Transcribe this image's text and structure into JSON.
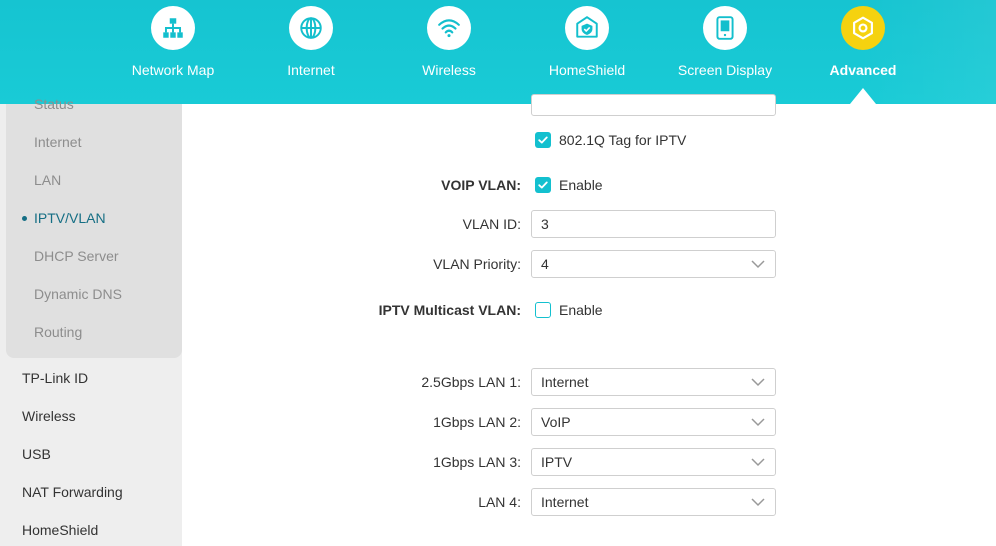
{
  "nav": {
    "items": [
      {
        "label": "Network Map",
        "icon": "network-map-icon"
      },
      {
        "label": "Internet",
        "icon": "globe-icon"
      },
      {
        "label": "Wireless",
        "icon": "wifi-icon"
      },
      {
        "label": "HomeShield",
        "icon": "home-shield-icon"
      },
      {
        "label": "Screen Display",
        "icon": "screen-display-icon"
      },
      {
        "label": "Advanced",
        "icon": "gear-icon",
        "active": true
      }
    ],
    "accent_color": "#16c4d1",
    "active_color": "#f5d20f"
  },
  "sidebar": {
    "sub_items": [
      {
        "label": "Status"
      },
      {
        "label": "Internet"
      },
      {
        "label": "LAN"
      },
      {
        "label": "IPTV/VLAN",
        "active": true
      },
      {
        "label": "DHCP Server"
      },
      {
        "label": "Dynamic DNS"
      },
      {
        "label": "Routing"
      }
    ],
    "main_items": [
      {
        "label": "TP-Link ID"
      },
      {
        "label": "Wireless"
      },
      {
        "label": "USB"
      },
      {
        "label": "NAT Forwarding"
      },
      {
        "label": "HomeShield"
      }
    ]
  },
  "form": {
    "iptv_tag_label": "802.1Q Tag for IPTV",
    "voip_vlan_label": "VOIP VLAN:",
    "voip_enable_label": "Enable",
    "vlan_id_label": "VLAN ID:",
    "vlan_id_value": "3",
    "vlan_priority_label": "VLAN Priority:",
    "vlan_priority_value": "4",
    "iptv_multicast_label": "IPTV Multicast VLAN:",
    "iptv_multicast_enable_label": "Enable",
    "lan_ports": [
      {
        "label": "2.5Gbps LAN 1:",
        "value": "Internet"
      },
      {
        "label": "1Gbps LAN 2:",
        "value": "VoIP"
      },
      {
        "label": "1Gbps LAN 3:",
        "value": "IPTV"
      },
      {
        "label": "LAN 4:",
        "value": "Internet"
      }
    ]
  }
}
